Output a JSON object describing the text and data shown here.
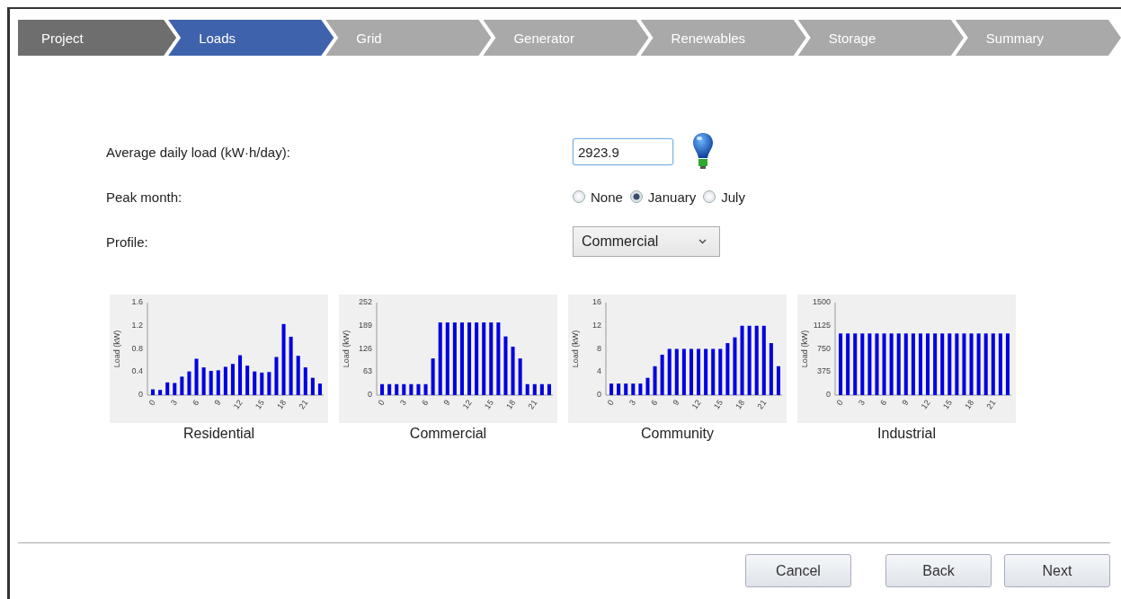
{
  "steps": [
    {
      "label": "Project",
      "completed": true,
      "selected": false
    },
    {
      "label": "Loads",
      "completed": false,
      "selected": true
    },
    {
      "label": "Grid",
      "completed": false,
      "selected": false
    },
    {
      "label": "Generator",
      "completed": false,
      "selected": false
    },
    {
      "label": "Renewables",
      "completed": false,
      "selected": false
    },
    {
      "label": "Storage",
      "completed": false,
      "selected": false
    },
    {
      "label": "Summary",
      "completed": false,
      "selected": false
    }
  ],
  "form": {
    "daily_load": {
      "label": "Average daily load (kW·h/day):",
      "value": "2923.9"
    },
    "peak_month": {
      "label": "Peak month:",
      "options": [
        {
          "label": "None",
          "selected": false
        },
        {
          "label": "January",
          "selected": true
        },
        {
          "label": "July",
          "selected": false
        }
      ]
    },
    "profile": {
      "label": "Profile:",
      "value": "Commercial"
    }
  },
  "profiles": [
    {
      "caption": "Residential",
      "chart_data": {
        "type": "bar",
        "ylabel": "Load (kW)",
        "x": [
          0,
          1,
          2,
          3,
          4,
          5,
          6,
          7,
          8,
          9,
          10,
          11,
          12,
          13,
          14,
          15,
          16,
          17,
          18,
          19,
          20,
          21,
          22,
          23
        ],
        "xlim": [
          -0.5,
          23.5
        ],
        "series": [
          {
            "color": "#0000e0",
            "values": [
              0.1,
              0.09,
              0.22,
              0.21,
              0.32,
              0.41,
              0.63,
              0.48,
              0.42,
              0.43,
              0.49,
              0.54,
              0.69,
              0.51,
              0.41,
              0.39,
              0.4,
              0.66,
              1.23,
              1.01,
              0.68,
              0.48,
              0.3,
              0.2
            ]
          }
        ],
        "ylim": [
          0,
          1.6
        ],
        "yticks": [
          0,
          0.4,
          0.8,
          1.2,
          1.6
        ],
        "xticks": [
          0,
          3,
          6,
          9,
          12,
          15,
          18,
          21
        ]
      }
    },
    {
      "caption": "Commercial",
      "chart_data": {
        "type": "bar",
        "ylabel": "Load (kW)",
        "x": [
          0,
          1,
          2,
          3,
          4,
          5,
          6,
          7,
          8,
          9,
          10,
          11,
          12,
          13,
          14,
          15,
          16,
          17,
          18,
          19,
          20,
          21,
          22,
          23
        ],
        "xlim": [
          -0.5,
          23.5
        ],
        "series": [
          {
            "color": "#0000e0",
            "values": [
              30,
              30,
              30,
              30,
              30,
              30,
              30,
              100,
              198,
              198,
              198,
              198,
              198,
              198,
              198,
              198,
              198,
              160,
              132,
              100,
              30,
              30,
              30,
              30
            ]
          }
        ],
        "ylim": [
          0,
          252
        ],
        "yticks": [
          0,
          63,
          126,
          189,
          252
        ],
        "xticks": [
          0,
          3,
          6,
          9,
          12,
          15,
          18,
          21
        ]
      }
    },
    {
      "caption": "Community",
      "chart_data": {
        "type": "bar",
        "ylabel": "Load (kW)",
        "x": [
          0,
          1,
          2,
          3,
          4,
          5,
          6,
          7,
          8,
          9,
          10,
          11,
          12,
          13,
          14,
          15,
          16,
          17,
          18,
          19,
          20,
          21,
          22,
          23
        ],
        "xlim": [
          -0.5,
          23.5
        ],
        "series": [
          {
            "color": "#0000e0",
            "values": [
              2,
              2,
              2,
              2,
              2,
              3,
              5,
              7,
              8,
              8,
              8,
              8,
              8,
              8,
              8,
              8,
              9,
              10,
              12,
              12,
              12,
              12,
              9,
              5
            ]
          }
        ],
        "ylim": [
          0,
          16
        ],
        "yticks": [
          0,
          4,
          8,
          12,
          16
        ],
        "xticks": [
          0,
          3,
          6,
          9,
          12,
          15,
          18,
          21
        ]
      }
    },
    {
      "caption": "Industrial",
      "chart_data": {
        "type": "bar",
        "ylabel": "Load (kW)",
        "x": [
          0,
          1,
          2,
          3,
          4,
          5,
          6,
          7,
          8,
          9,
          10,
          11,
          12,
          13,
          14,
          15,
          16,
          17,
          18,
          19,
          20,
          21,
          22,
          23
        ],
        "xlim": [
          -0.5,
          23.5
        ],
        "series": [
          {
            "color": "#0000e0",
            "values": [
              1000,
              1000,
              1000,
              1000,
              1000,
              1000,
              1000,
              1000,
              1000,
              1000,
              1000,
              1000,
              1000,
              1000,
              1000,
              1000,
              1000,
              1000,
              1000,
              1000,
              1000,
              1000,
              1000,
              1000
            ]
          }
        ],
        "ylim": [
          0,
          1500
        ],
        "yticks": [
          0,
          375,
          750,
          1125,
          1500
        ],
        "xticks": [
          0,
          3,
          6,
          9,
          12,
          15,
          18,
          21
        ]
      }
    }
  ],
  "buttons": [
    {
      "label": "Cancel"
    },
    {
      "label": "Back"
    },
    {
      "label": "Next"
    }
  ]
}
